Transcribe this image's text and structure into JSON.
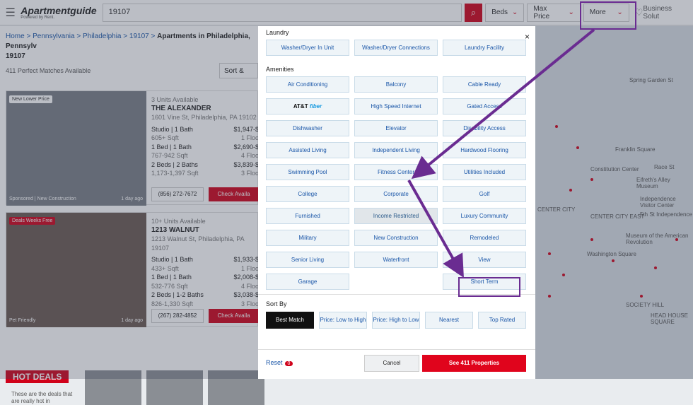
{
  "header": {
    "logo_main": "Apartmentguide",
    "logo_sub": "Powered by Rent.",
    "search_value": "19107",
    "filters": [
      {
        "label": "Beds"
      },
      {
        "label": "Max Price"
      },
      {
        "label": "More"
      }
    ],
    "business": "Business Solut"
  },
  "breadcrumb": {
    "home": "Home",
    "state": "Pennsylvania",
    "city": "Philadelphia",
    "zip": "19107",
    "current": "Apartments in Philadelphia, Pennsylv",
    "current2": "19107"
  },
  "results": {
    "count": "411 Perfect Matches Available",
    "sort_label": "Sort &"
  },
  "listings": [
    {
      "badge": "New Lower Price",
      "units": "3 Units Available",
      "name": "THE ALEXANDER",
      "address": "1601 Vine St, Philadelphia, PA 19102",
      "rows": [
        {
          "a": "Studio | 1 Bath",
          "b": "$1,947-$"
        },
        {
          "a": "605+ Sqft",
          "b": "1 Floo",
          "sub": true
        },
        {
          "a": "1 Bed | 1 Bath",
          "b": "$2,690-$"
        },
        {
          "a": "767-942 Sqft",
          "b": "4 Floo",
          "sub": true
        },
        {
          "a": "2 Beds | 2 Baths",
          "b": "$3,839-$"
        },
        {
          "a": "1,173-1,397 Sqft",
          "b": "3 Floo",
          "sub": true
        }
      ],
      "phone": "(856) 272-7672",
      "check": "Check Availa",
      "foot": "Sponsored | New Construction",
      "ago": "1 day ago"
    },
    {
      "badge": "Deals  Weeks Free",
      "units": "10+ Units Available",
      "name": "1213 WALNUT",
      "address": "1213 Walnut St, Philadelphia, PA 19107",
      "rows": [
        {
          "a": "Studio | 1 Bath",
          "b": "$1,933-$"
        },
        {
          "a": "433+ Sqft",
          "b": "1 Floo",
          "sub": true
        },
        {
          "a": "1 Bed | 1 Bath",
          "b": "$2,008-$"
        },
        {
          "a": "532-776 Sqft",
          "b": "4 Floo",
          "sub": true
        },
        {
          "a": "2 Beds | 1-2 Baths",
          "b": "$3,038-$"
        },
        {
          "a": "826-1,330 Sqft",
          "b": "3 Floo",
          "sub": true
        }
      ],
      "phone": "(267) 282-4852",
      "check": "Check Availa",
      "foot": "Pet Friendly",
      "ago": "1 day ago"
    }
  ],
  "hot_deals": {
    "title": "HOT DEALS",
    "desc": "These are the deals that are really hot in"
  },
  "map_labels": [
    "Franklin Square",
    "Race St",
    "Eifreth's Alley Museum",
    "Independence Visitor Center",
    "5th St Independence",
    "Museum of the American Revolution",
    "Washington Square",
    "CENTER CITY",
    "CENTER CITY EAST",
    "SOCIETY HILL",
    "HEAD HOUSE SQUARE",
    "Spring Garden St",
    "Constitution Center"
  ],
  "modal": {
    "close": "×",
    "laundry_title": "Laundry",
    "laundry": [
      "Washer/Dryer In Unit",
      "Washer/Dryer Connections",
      "Laundry Facility"
    ],
    "amenities_title": "Amenities",
    "amenities": [
      "Air Conditioning",
      "Balcony",
      "Cable Ready",
      "AT&T fiber",
      "High Speed Internet",
      "Gated Access",
      "Dishwasher",
      "Elevator",
      "Disability Access",
      "Assisted Living",
      "Independent Living",
      "Hardwood Flooring",
      "Swimming Pool",
      "Fitness Center",
      "Utilities Included",
      "College",
      "Corporate",
      "Golf",
      "Furnished",
      "Income Restricted",
      "Luxury Community",
      "Military",
      "New Construction",
      "Remodeled",
      "Senior Living",
      "Waterfront",
      "View",
      "Garage",
      "",
      "Short Term"
    ],
    "att_prefix": "AT&T",
    "att_brand": "fiber",
    "sort_title": "Sort By",
    "sort": [
      "Best Match",
      "Price: Low to High",
      "Price: High to Low",
      "Nearest",
      "Top Rated"
    ],
    "reset": "Reset",
    "reset_count": "0",
    "cancel": "Cancel",
    "see": "See 411 Properties"
  },
  "colors": {
    "accent": "#d0021b",
    "link": "#1a56a8",
    "annotation": "#6a2c91"
  }
}
